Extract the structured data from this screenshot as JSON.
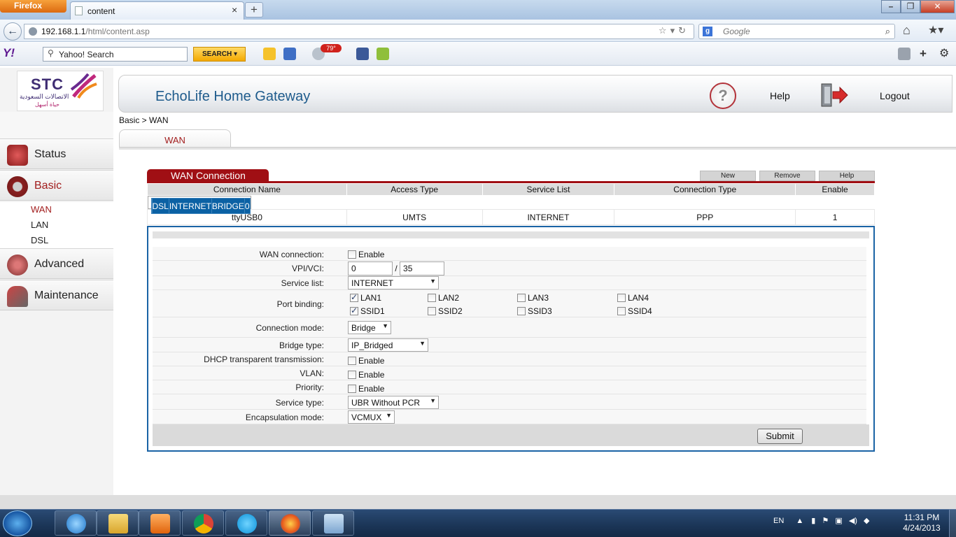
{
  "browser": {
    "app_button": "Firefox",
    "tab_title": "content",
    "url_host": "192.168.1.1",
    "url_path": "/html/content.asp",
    "search_placeholder": "Google",
    "window_controls": {
      "minimize": "minimize-icon",
      "maximize": "maximize-icon",
      "close": "close-icon"
    }
  },
  "yahoo_toolbar": {
    "logo": "Y!",
    "search_value": "Yahoo! Search",
    "search_button": "SEARCH",
    "weather_badge": "79°"
  },
  "gateway": {
    "logo_text": "STC",
    "logo_arabic": "الاتصالات السعودية",
    "logo_tagline": "حياة أسهل",
    "product_title": "EchoLife Home Gateway",
    "help_label": "Help",
    "logout_label": "Logout",
    "breadcrumb": "Basic > WAN",
    "subtab": "WAN"
  },
  "nav": {
    "status": "Status",
    "basic": "Basic",
    "basic_items": [
      "WAN",
      "LAN",
      "DSL"
    ],
    "advanced": "Advanced",
    "maintenance": "Maintenance"
  },
  "wan": {
    "header": "WAN Connection",
    "buttons": {
      "new": "New",
      "remove": "Remove",
      "help": "Help"
    },
    "columns": [
      "Connection Name",
      "Access Type",
      "Service List",
      "Connection Type",
      "Enable"
    ],
    "rows": [
      [
        "",
        "DSL",
        "INTERNET",
        "BRIDGE",
        "0"
      ],
      [
        "ttyUSB0",
        "UMTS",
        "INTERNET",
        "PPP",
        "1"
      ]
    ]
  },
  "form": {
    "wan_connection_label": "WAN connection:",
    "enable_text": "Enable",
    "wan_connection_enabled": false,
    "vpi_vci_label": "VPI/VCI:",
    "vpi": "0",
    "vci_sep": "/",
    "vci": "35",
    "service_list_label": "Service list:",
    "service_list_value": "INTERNET",
    "port_binding_label": "Port binding:",
    "ports": [
      "LAN1",
      "LAN2",
      "LAN3",
      "LAN4",
      "SSID1",
      "SSID2",
      "SSID3",
      "SSID4"
    ],
    "port_checked": [
      true,
      false,
      false,
      false,
      true,
      false,
      false,
      false
    ],
    "connection_mode_label": "Connection mode:",
    "connection_mode_value": "Bridge",
    "bridge_type_label": "Bridge type:",
    "bridge_type_value": "IP_Bridged",
    "dhcp_label": "DHCP transparent transmission:",
    "vlan_label": "VLAN:",
    "priority_label": "Priority:",
    "service_type_label": "Service type:",
    "service_type_value": "UBR Without PCR",
    "encap_label": "Encapsulation mode:",
    "encap_value": "VCMUX",
    "submit": "Submit"
  },
  "taskbar": {
    "lang": "EN",
    "time": "11:31 PM",
    "date": "4/24/2013"
  },
  "colors": {
    "accent_red": "#a00f14",
    "selected_row_blue": "#0b61a4",
    "panel_border": "#1a63a5"
  }
}
